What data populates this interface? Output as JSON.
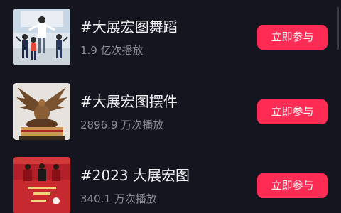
{
  "topics": [
    {
      "title": "#大展宏图舞蹈",
      "stats": "1.9 亿次播放",
      "button": "立即参与",
      "thumb_icon": "dance-group-thumbnail"
    },
    {
      "title": "#大展宏图摆件",
      "stats": "2896.9 万次播放",
      "button": "立即参与",
      "thumb_icon": "eagle-statue-thumbnail"
    },
    {
      "title": "#2023 大展宏图",
      "stats": "340.1 万次播放",
      "button": "立即参与",
      "thumb_icon": "new-year-greeting-thumbnail"
    }
  ],
  "colors": {
    "background": "#15151f",
    "accent": "#fe2c55",
    "secondary_text": "#8c8c99"
  }
}
